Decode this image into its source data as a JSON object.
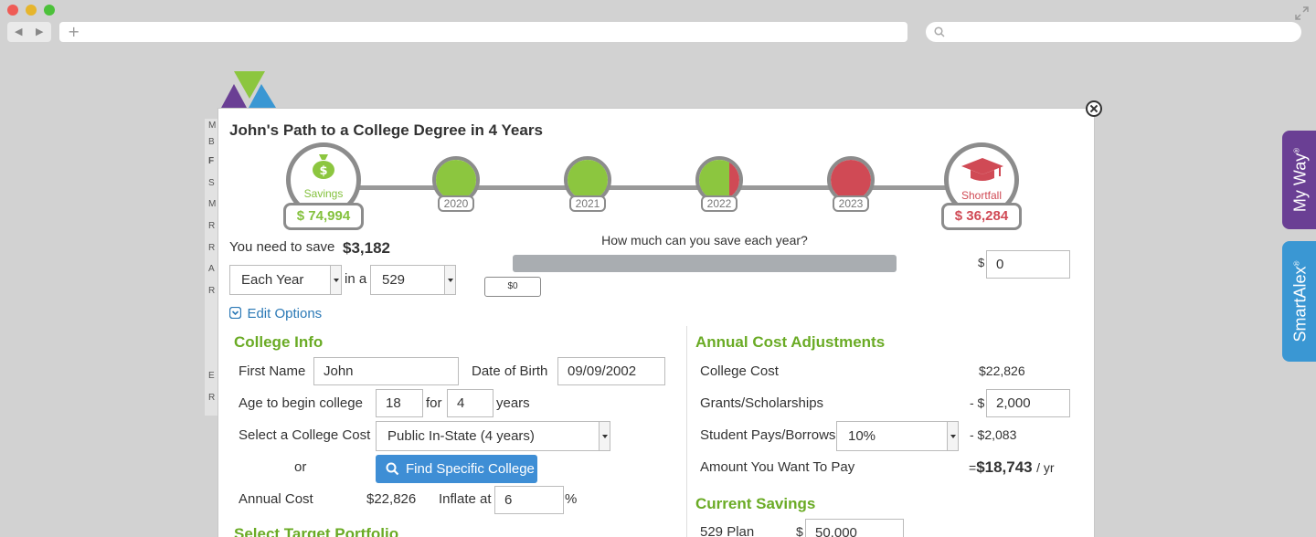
{
  "browser": {
    "colors": {
      "close": "#ef5b55",
      "minimize": "#e6b52c",
      "maximize": "#4cc13a"
    },
    "url_value": "",
    "search_value": ""
  },
  "background_app": {
    "strip_letters": [
      "M",
      "B",
      "F",
      "S",
      "M",
      "R",
      "R",
      "A",
      "R",
      "E",
      "R"
    ]
  },
  "side_tabs": {
    "my_way": {
      "label": "My Way",
      "mark": "®",
      "color": "#6a3f94"
    },
    "smart_alex": {
      "label": "SmartAlex",
      "mark": "®",
      "color": "#3a97d3"
    }
  },
  "modal": {
    "title": "John's Path to a College Degree in 4 Years",
    "timeline": {
      "savings": {
        "label": "Savings",
        "amount": "$ 74,994",
        "icon": "money-bag-icon"
      },
      "years": [
        {
          "label": "2020",
          "funded_fraction": 1.0
        },
        {
          "label": "2021",
          "funded_fraction": 1.0
        },
        {
          "label": "2022",
          "funded_fraction": 0.75
        },
        {
          "label": "2023",
          "funded_fraction": 0.0
        }
      ],
      "shortfall": {
        "label": "Shortfall",
        "amount": "$ 36,284",
        "icon": "graduation-cap-icon"
      },
      "colors": {
        "funded": "#8cc63f",
        "shortfall": "#d04a55",
        "ring": "#8c8c8c"
      }
    },
    "save": {
      "need_label": "You need to save",
      "need_amount": "$3,182",
      "frequency": "Each Year",
      "in_a_label": "in a",
      "account": "529",
      "question": "How much can you save each year?",
      "slider_value": "$0",
      "currency": "$",
      "amount_input": "0"
    },
    "edit_options": "Edit Options",
    "college_info": {
      "heading": "College Info",
      "first_name_label": "First Name",
      "first_name": "John",
      "dob_label": "Date of Birth",
      "dob": "09/09/2002",
      "age_label": "Age to begin college",
      "age": "18",
      "for_label": "for",
      "years_value": "4",
      "years_label": "years",
      "college_cost_label": "Select a College Cost",
      "college_cost": "Public In-State (4 years)",
      "or_label": "or",
      "find_button": "Find Specific College",
      "annual_cost_label": "Annual Cost",
      "annual_cost_currency": "$",
      "annual_cost": "22,826",
      "inflate_label": "Inflate at",
      "inflate_value": "6",
      "percent": "%"
    },
    "target_portfolio_heading": "Select Target Portfolio",
    "adjustments": {
      "heading": "Annual Cost Adjustments",
      "college_cost_label": "College Cost",
      "college_cost": "$22,826",
      "grants_label": "Grants/Scholarships",
      "grants_prefix": "- $",
      "grants_value": "2,000",
      "student_label": "Student Pays/Borrows",
      "student_percent": "10%",
      "student_amount": "- $2,083",
      "want_label": "Amount You Want To Pay",
      "want_prefix": "=",
      "want_amount": "$18,743",
      "want_suffix": "/ yr"
    },
    "current_savings": {
      "heading": "Current Savings",
      "plan_label": "529 Plan",
      "currency": "$",
      "plan_value": "50,000"
    }
  }
}
